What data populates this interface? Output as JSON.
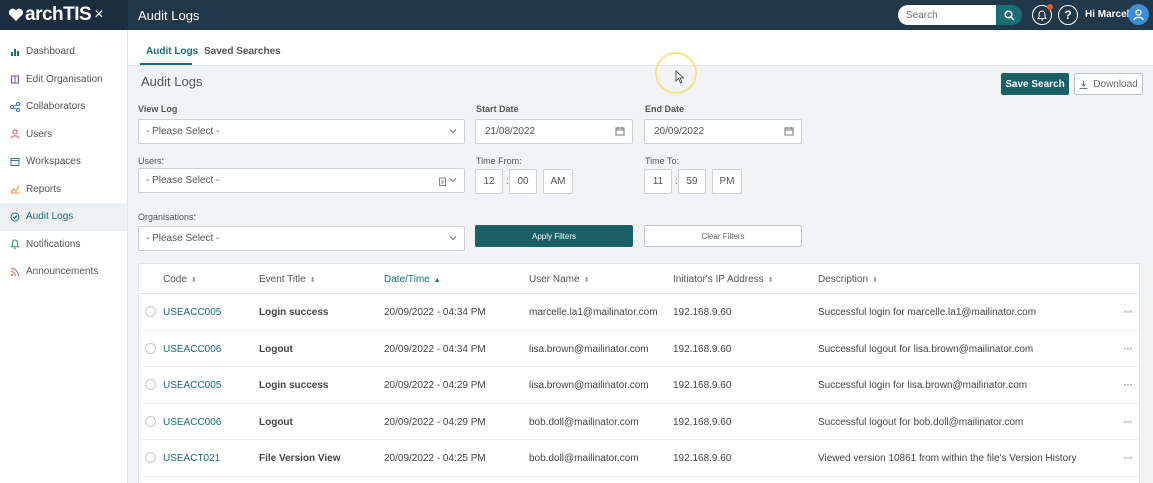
{
  "app": {
    "logo": "archTIS",
    "logo_suffix": "×",
    "title": "Audit Logs"
  },
  "header": {
    "search_placeholder": "Search",
    "help": "?",
    "greeting": "Hi Marcelle"
  },
  "sidebar": {
    "items": [
      {
        "label": "Dashboard",
        "icon": "bar-chart-icon"
      },
      {
        "label": "Edit Organisation",
        "icon": "building-icon"
      },
      {
        "label": "Collaborators",
        "icon": "share-icon"
      },
      {
        "label": "Users",
        "icon": "user-icon"
      },
      {
        "label": "Workspaces",
        "icon": "workspace-icon"
      },
      {
        "label": "Reports",
        "icon": "line-chart-icon"
      },
      {
        "label": "Audit Logs",
        "icon": "audit-icon"
      },
      {
        "label": "Notifications",
        "icon": "bell-icon"
      },
      {
        "label": "Announcements",
        "icon": "rss-icon"
      }
    ],
    "active_index": 6
  },
  "tabs": [
    {
      "label": "Audit Logs"
    },
    {
      "label": "Saved Searches"
    }
  ],
  "page": {
    "section_title": "Audit Logs",
    "save_search": "Save Search",
    "download": "Download"
  },
  "filters": {
    "view_log_label": "View Log",
    "view_log_value": "- Please Select -",
    "start_date_label": "Start Date",
    "start_date_value": "21/08/2022",
    "end_date_label": "End Date",
    "end_date_value": "20/09/2022",
    "users_label": "Users:",
    "users_value": "- Please Select -",
    "time_from_label": "Time From:",
    "time_from": {
      "hour": "12",
      "minute": "00",
      "ampm": "AM"
    },
    "time_to_label": "Time To:",
    "time_to": {
      "hour": "11",
      "minute": "59",
      "ampm": "PM"
    },
    "separator": ":",
    "orgs_label": "Organisations:",
    "orgs_value": "- Please Select -",
    "apply": "Apply Filters",
    "clear": "Clear Filters"
  },
  "table": {
    "columns": [
      "Code",
      "Event Title",
      "Date/Time",
      "User Name",
      "Initiator's IP Address",
      "Description"
    ],
    "sorted_column": "Date/Time",
    "rows": [
      {
        "code": "USEACC005",
        "event": "Login success",
        "datetime": "20/09/2022 - 04:34 PM",
        "user": "marcelle.la1@mailinator.com",
        "ip": "192.168.9.60",
        "desc": "Successful login for marcelle.la1@mailinator.com"
      },
      {
        "code": "USEACC006",
        "event": "Logout",
        "datetime": "20/09/2022 - 04:34 PM",
        "user": "lisa.brown@mailinator.com",
        "ip": "192.168.9.60",
        "desc": "Successful logout for lisa.brown@mailinator.com"
      },
      {
        "code": "USEACC005",
        "event": "Login success",
        "datetime": "20/09/2022 - 04:29 PM",
        "user": "lisa.brown@mailinator.com",
        "ip": "192.168.9.60",
        "desc": "Successful login for lisa.brown@mailinator.com"
      },
      {
        "code": "USEACC006",
        "event": "Logout",
        "datetime": "20/09/2022 - 04:29 PM",
        "user": "bob.doll@mailinator.com",
        "ip": "192.168.9.60",
        "desc": "Successful logout for bob.doll@mailinator.com"
      },
      {
        "code": "USEACT021",
        "event": "File Version View",
        "datetime": "20/09/2022 - 04:25 PM",
        "user": "bob.doll@mailinator.com",
        "ip": "192.168.9.60",
        "desc": "Viewed version 10861 from within the file's Version History"
      }
    ],
    "row_menu": "···"
  },
  "colors": {
    "topbar": "#21374a",
    "accent": "#1a6d73",
    "primary_button": "#195f66"
  }
}
